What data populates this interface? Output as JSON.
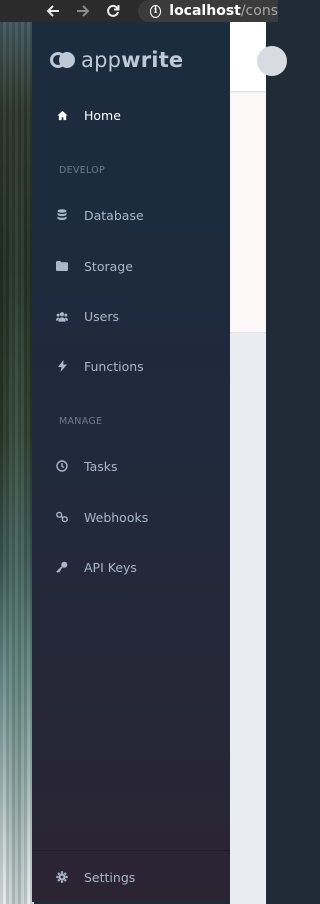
{
  "browser": {
    "url_host": "localhost",
    "url_path": "/cons",
    "icons": {
      "back": "arrow-left-icon",
      "forward": "arrow-right-icon",
      "reload": "reload-icon",
      "info": "info-icon"
    }
  },
  "app": {
    "logo_prefix": "app",
    "logo_suffix": "write"
  },
  "sidebar": {
    "home": {
      "label": "Home",
      "icon": "home-icon"
    },
    "develop_label": "DEVELOP",
    "develop_items": [
      {
        "label": "Database",
        "icon": "database-icon"
      },
      {
        "label": "Storage",
        "icon": "folder-icon"
      },
      {
        "label": "Users",
        "icon": "users-icon"
      },
      {
        "label": "Functions",
        "icon": "lightning-icon"
      }
    ],
    "manage_label": "MANAGE",
    "manage_items": [
      {
        "label": "Tasks",
        "icon": "clock-icon"
      },
      {
        "label": "Webhooks",
        "icon": "link-icon"
      },
      {
        "label": "API Keys",
        "icon": "key-icon"
      }
    ],
    "settings": {
      "label": "Settings",
      "icon": "gear-icon"
    }
  },
  "colors": {
    "sidebar_top": "#1b2c3f",
    "sidebar_bottom": "#2b2433",
    "nav_text": "#a9b7c8",
    "active_text": "#ffffff",
    "section_label": "#6b7b8f",
    "logo": "#bfc9d6"
  }
}
